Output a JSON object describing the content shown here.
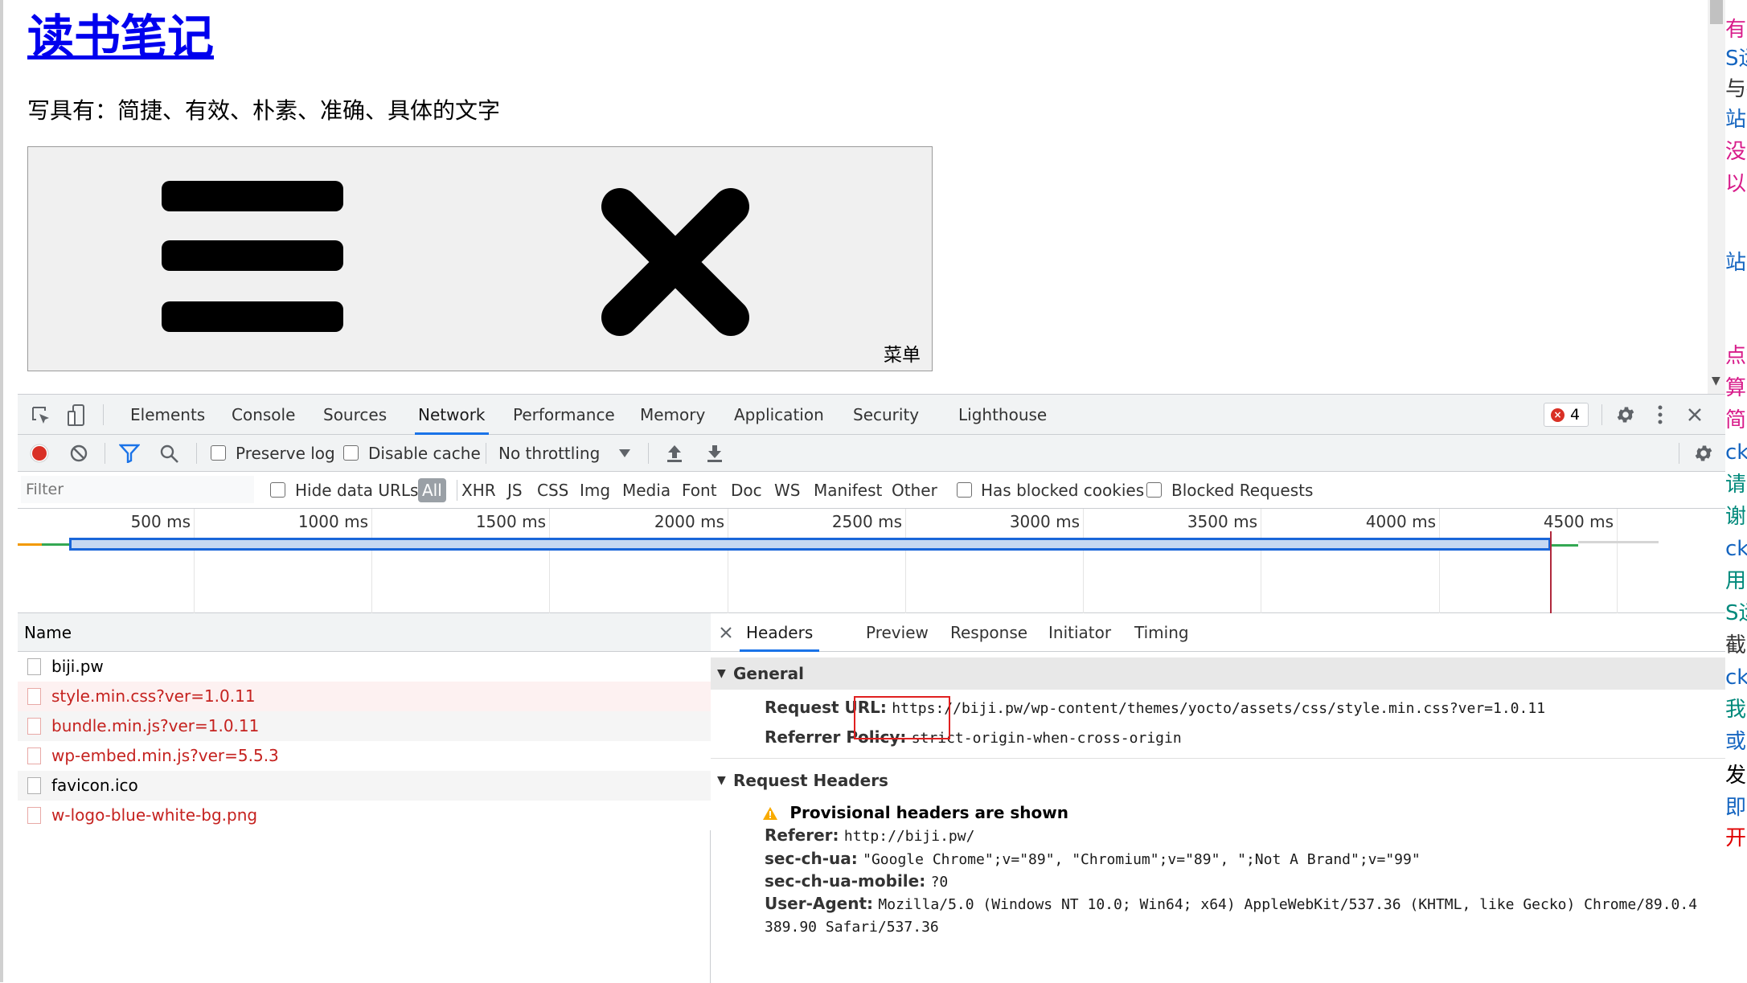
{
  "page": {
    "site_title": "读书笔记",
    "tagline": "写具有：简捷、有效、朴素、准确、具体的文字",
    "menu_label": "菜单"
  },
  "right_strip": [
    {
      "text": "有",
      "color": "#d81b8a"
    },
    {
      "text": "S运",
      "color": "#1565c0"
    },
    {
      "text": "与抽",
      "color": "#333333"
    },
    {
      "text": "站(",
      "color": "#1565c0"
    },
    {
      "text": "没",
      "color": "#d81b8a"
    },
    {
      "text": "以",
      "color": "#d81b8a"
    },
    {
      "text": "站(",
      "color": "#1565c0"
    },
    {
      "text": "点",
      "color": "#d81b8a"
    },
    {
      "text": "算",
      "color": "#d81b8a"
    },
    {
      "text": "简",
      "color": "#d81b8a"
    },
    {
      "text": "ck(",
      "color": "#1565c0"
    },
    {
      "text": "请",
      "color": "#00897b"
    },
    {
      "text": "谢",
      "color": "#00897b"
    },
    {
      "text": "ck(",
      "color": "#1565c0"
    },
    {
      "text": "用的",
      "color": "#00897b"
    },
    {
      "text": "S运",
      "color": "#00897b"
    },
    {
      "text": "截图",
      "color": "#333333"
    },
    {
      "text": "ck(",
      "color": "#1565c0"
    },
    {
      "text": "我",
      "color": "#00897b"
    },
    {
      "text": "或",
      "color": "#1565c0"
    },
    {
      "text": "发",
      "color": "#000000"
    },
    {
      "text": "即<",
      "color": "#1565c0"
    },
    {
      "text": "开",
      "color": "#e00000"
    }
  ],
  "devtools": {
    "tabs": [
      "Elements",
      "Console",
      "Sources",
      "Network",
      "Performance",
      "Memory",
      "Application",
      "Security",
      "Lighthouse"
    ],
    "active_tab": "Network",
    "error_count": "4",
    "toolbar": {
      "preserve_log": "Preserve log",
      "disable_cache": "Disable cache",
      "throttling": "No throttling"
    },
    "filter": {
      "placeholder": "Filter",
      "hide_data_urls": "Hide data URLs",
      "types": [
        "All",
        "XHR",
        "JS",
        "CSS",
        "Img",
        "Media",
        "Font",
        "Doc",
        "WS",
        "Manifest",
        "Other"
      ],
      "has_blocked_cookies": "Has blocked cookies",
      "blocked_requests": "Blocked Requests"
    },
    "timeline_ticks": [
      "500 ms",
      "1000 ms",
      "1500 ms",
      "2000 ms",
      "2500 ms",
      "3000 ms",
      "3500 ms",
      "4000 ms",
      "4500 ms"
    ],
    "name_header": "Name",
    "requests": [
      {
        "name": "biji.pw",
        "status": "ok"
      },
      {
        "name": "style.min.css?ver=1.0.11",
        "status": "error"
      },
      {
        "name": "bundle.min.js?ver=1.0.11",
        "status": "error"
      },
      {
        "name": "wp-embed.min.js?ver=5.5.3",
        "status": "error"
      },
      {
        "name": "favicon.ico",
        "status": "ok"
      },
      {
        "name": "w-logo-blue-white-bg.png",
        "status": "error"
      }
    ],
    "detail_tabs": [
      "Headers",
      "Preview",
      "Response",
      "Initiator",
      "Timing"
    ],
    "active_detail_tab": "Headers",
    "general": {
      "title": "General",
      "request_url_label": "Request URL:",
      "request_url": "https://biji.pw/wp-content/themes/yocto/assets/css/style.min.css?ver=1.0.11",
      "referrer_policy_label": "Referrer Policy:",
      "referrer_policy": "strict-origin-when-cross-origin"
    },
    "request_headers": {
      "title": "Request Headers",
      "warning": "Provisional headers are shown",
      "referer_label": "Referer:",
      "referer": "http://biji.pw/",
      "sec_ch_ua_label": "sec-ch-ua:",
      "sec_ch_ua": "\"Google Chrome\";v=\"89\", \"Chromium\";v=\"89\", \";Not A Brand\";v=\"99\"",
      "sec_ch_ua_mobile_label": "sec-ch-ua-mobile:",
      "sec_ch_ua_mobile": "?0",
      "user_agent_label": "User-Agent:",
      "user_agent": "Mozilla/5.0 (Windows NT 10.0; Win64; x64) AppleWebKit/537.36 (KHTML, like Gecko) Chrome/89.0.4",
      "user_agent_cont": "389.90 Safari/537.36"
    }
  }
}
